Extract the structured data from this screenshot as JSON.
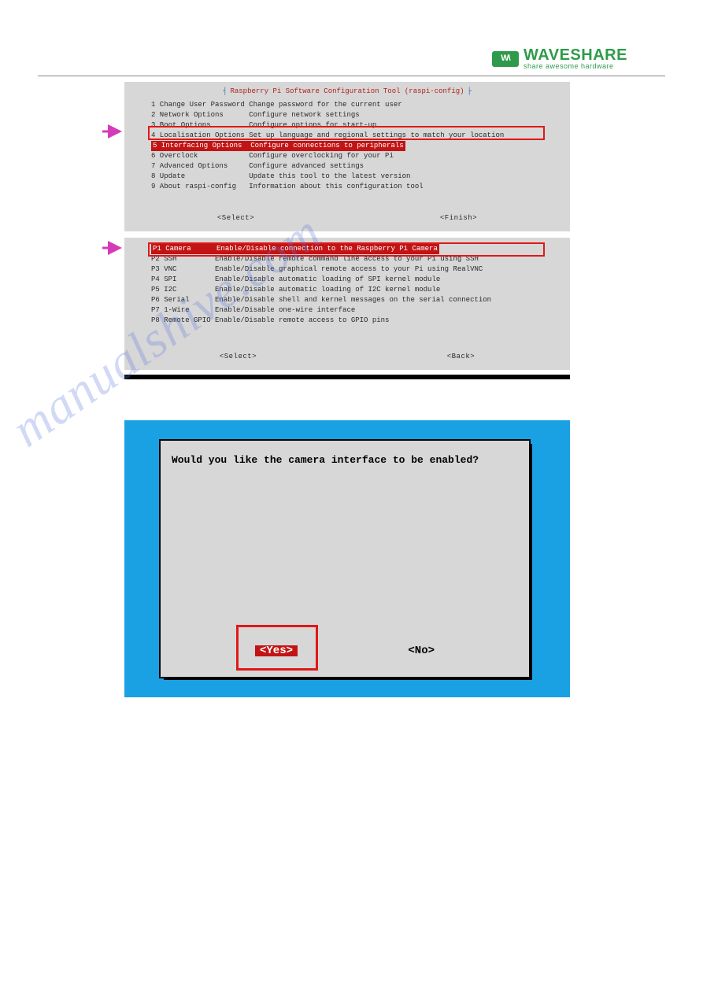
{
  "logo": {
    "badge": "W\\",
    "brand": "WAVESHARE",
    "tagline": "share awesome hardware"
  },
  "watermark": "manualshive.com",
  "panel1": {
    "title": "Raspberry Pi Software Configuration Tool (raspi-config)",
    "items": [
      {
        "k": "1 Change User Password",
        "d": "Change password for the current user"
      },
      {
        "k": "2 Network Options",
        "d": "Configure network settings"
      },
      {
        "k": "3 Boot Options",
        "d": "Configure options for start-up"
      },
      {
        "k": "4 Localisation Options",
        "d": "Set up language and regional settings to match your location"
      },
      {
        "k": "5 Interfacing Options",
        "d": "Configure connections to peripherals",
        "highlight": true
      },
      {
        "k": "6 Overclock",
        "d": "Configure overclocking for your Pi"
      },
      {
        "k": "7 Advanced Options",
        "d": "Configure advanced settings"
      },
      {
        "k": "8 Update",
        "d": "Update this tool to the latest version"
      },
      {
        "k": "9 About raspi-config",
        "d": "Information about this configuration tool"
      }
    ],
    "select": "<Select>",
    "finish": "<Finish>"
  },
  "panel2": {
    "items": [
      {
        "k": "P1 Camera",
        "d": "Enable/Disable connection to the Raspberry Pi Camera",
        "highlight": true
      },
      {
        "k": "P2 SSH",
        "d": "Enable/Disable remote command line access to your Pi using SSH"
      },
      {
        "k": "P3 VNC",
        "d": "Enable/Disable graphical remote access to your Pi using RealVNC"
      },
      {
        "k": "P4 SPI",
        "d": "Enable/Disable automatic loading of SPI kernel module"
      },
      {
        "k": "P5 I2C",
        "d": "Enable/Disable automatic loading of I2C kernel module"
      },
      {
        "k": "P6 Serial",
        "d": "Enable/Disable shell and kernel messages on the serial connection"
      },
      {
        "k": "P7 1-Wire",
        "d": "Enable/Disable one-wire interface"
      },
      {
        "k": "P8 Remote GPIO",
        "d": "Enable/Disable remote access to GPIO pins"
      }
    ],
    "select": "<Select>",
    "back": "<Back>"
  },
  "dialog": {
    "question": "Would you like the camera interface to be enabled?",
    "yes": "<Yes>",
    "no": "<No>"
  }
}
